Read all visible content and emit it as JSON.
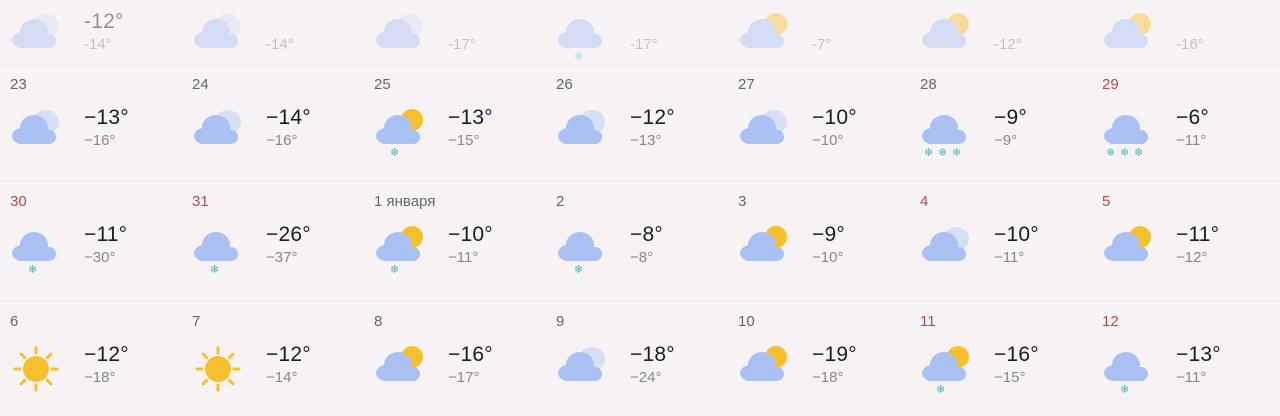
{
  "weeks": [
    {
      "days": [
        {
          "date": "",
          "day": "-12°",
          "night": "-14°",
          "icon": "cloudy-icon",
          "weekend": false
        },
        {
          "date": "",
          "day": "",
          "night": "-14°",
          "icon": "cloudy-icon",
          "weekend": false
        },
        {
          "date": "",
          "day": "",
          "night": "-17°",
          "icon": "cloudy-icon",
          "weekend": false
        },
        {
          "date": "",
          "day": "",
          "night": "-17°",
          "icon": "cloud-snow-icon",
          "weekend": false
        },
        {
          "date": "",
          "day": "",
          "night": "-7°",
          "icon": "partly-cloudy-icon",
          "weekend": false
        },
        {
          "date": "",
          "day": "",
          "night": "-12°",
          "icon": "partly-cloudy-icon",
          "weekend": false
        },
        {
          "date": "",
          "day": "",
          "night": "-16°",
          "icon": "partly-cloudy-icon",
          "weekend": false
        }
      ]
    },
    {
      "days": [
        {
          "date": "23",
          "day": "−13°",
          "night": "−16°",
          "icon": "cloudy-icon",
          "weekend": false
        },
        {
          "date": "24",
          "day": "−14°",
          "night": "−16°",
          "icon": "cloudy-icon",
          "weekend": false
        },
        {
          "date": "25",
          "day": "−13°",
          "night": "−15°",
          "icon": "partly-cloudy-snow-icon",
          "weekend": false
        },
        {
          "date": "26",
          "day": "−12°",
          "night": "−13°",
          "icon": "cloudy-icon",
          "weekend": false
        },
        {
          "date": "27",
          "day": "−10°",
          "night": "−10°",
          "icon": "cloudy-icon",
          "weekend": false
        },
        {
          "date": "28",
          "day": "−9°",
          "night": "−9°",
          "icon": "cloud-heavy-snow-icon",
          "weekend": false
        },
        {
          "date": "29",
          "day": "−6°",
          "night": "−11°",
          "icon": "cloud-heavy-snow-icon",
          "weekend": true
        }
      ]
    },
    {
      "days": [
        {
          "date": "30",
          "day": "−11°",
          "night": "−30°",
          "icon": "cloud-snow-icon",
          "weekend": true
        },
        {
          "date": "31",
          "day": "−26°",
          "night": "−37°",
          "icon": "cloud-snow-icon",
          "weekend": true
        },
        {
          "date": "1 января",
          "day": "−10°",
          "night": "−11°",
          "icon": "partly-cloudy-snow-icon",
          "weekend": false
        },
        {
          "date": "2",
          "day": "−8°",
          "night": "−8°",
          "icon": "cloud-snow-icon",
          "weekend": false
        },
        {
          "date": "3",
          "day": "−9°",
          "night": "−10°",
          "icon": "partly-cloudy-icon",
          "weekend": false
        },
        {
          "date": "4",
          "day": "−10°",
          "night": "−11°",
          "icon": "cloudy-icon",
          "weekend": true
        },
        {
          "date": "5",
          "day": "−11°",
          "night": "−12°",
          "icon": "partly-cloudy-icon",
          "weekend": true
        }
      ]
    },
    {
      "days": [
        {
          "date": "6",
          "day": "−12°",
          "night": "−18°",
          "icon": "sun-icon",
          "weekend": false
        },
        {
          "date": "7",
          "day": "−12°",
          "night": "−14°",
          "icon": "sun-icon",
          "weekend": false
        },
        {
          "date": "8",
          "day": "−16°",
          "night": "−17°",
          "icon": "partly-cloudy-icon",
          "weekend": false
        },
        {
          "date": "9",
          "day": "−18°",
          "night": "−24°",
          "icon": "cloudy-icon",
          "weekend": false
        },
        {
          "date": "10",
          "day": "−19°",
          "night": "−18°",
          "icon": "partly-cloudy-icon",
          "weekend": false
        },
        {
          "date": "11",
          "day": "−16°",
          "night": "−15°",
          "icon": "partly-cloudy-snow-icon",
          "weekend": true
        },
        {
          "date": "12",
          "day": "−13°",
          "night": "−11°",
          "icon": "cloud-snow-icon",
          "weekend": true
        }
      ]
    }
  ],
  "colors": {
    "cloud": "#a9c1f3",
    "cloud_back": "#d6dff3",
    "sun": "#f6c02d",
    "snow": "#52b3b4",
    "weekend": "#b8494b"
  }
}
